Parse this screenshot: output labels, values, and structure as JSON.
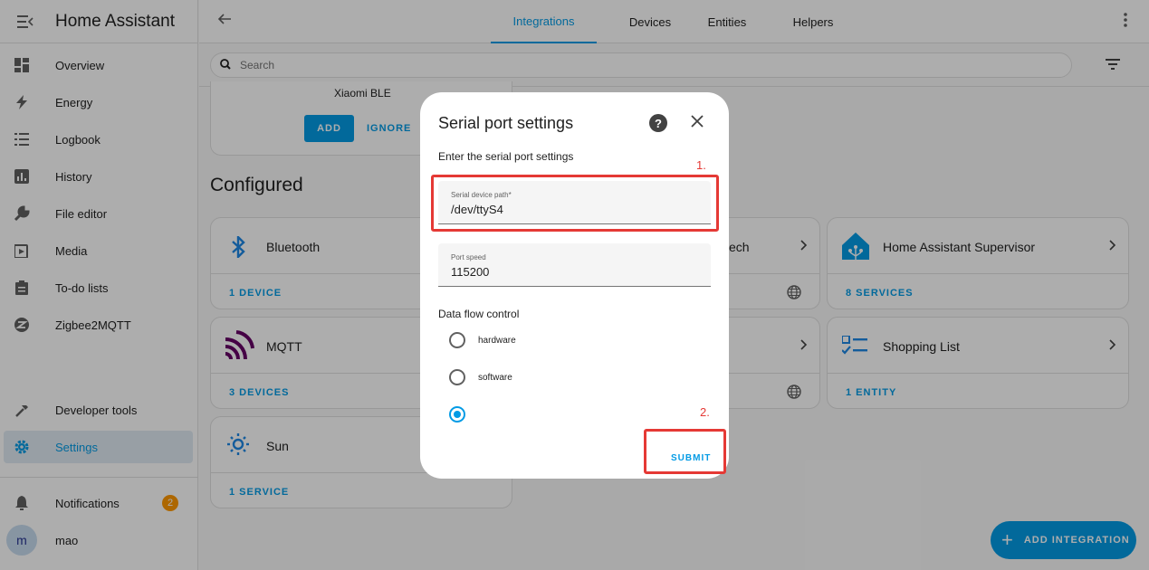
{
  "sidebar": {
    "title": "Home Assistant",
    "items": [
      {
        "label": "Overview"
      },
      {
        "label": "Energy"
      },
      {
        "label": "Logbook"
      },
      {
        "label": "History"
      },
      {
        "label": "File editor"
      },
      {
        "label": "Media"
      },
      {
        "label": "To-do lists"
      },
      {
        "label": "Zigbee2MQTT"
      }
    ],
    "developer_tools": "Developer tools",
    "settings": "Settings",
    "notifications": "Notifications",
    "notifications_count": "2",
    "user_initial": "m",
    "user_name": "mao"
  },
  "topbar": {
    "tabs": [
      "Integrations",
      "Devices",
      "Entities",
      "Helpers"
    ],
    "active_tab": "Integrations"
  },
  "search": {
    "placeholder": "Search"
  },
  "discovered": {
    "name": "Xiaomi BLE",
    "add_label": "ADD",
    "ignore_label": "IGNORE"
  },
  "configured": {
    "heading": "Configured",
    "cards": [
      {
        "name": "Bluetooth",
        "footer": "1 DEVICE"
      },
      {
        "name": "MQTT",
        "footer": "3 DEVICES"
      },
      {
        "name": "Sun",
        "footer": "1 SERVICE"
      },
      {
        "name": "ech",
        "footer": ""
      },
      {
        "name": "Home Assistant Supervisor",
        "footer": "8 SERVICES"
      },
      {
        "name": "Shopping List",
        "footer": "1 ENTITY"
      }
    ]
  },
  "fab": {
    "label": "ADD INTEGRATION"
  },
  "dialog": {
    "title": "Serial port settings",
    "description": "Enter the serial port settings",
    "fields": [
      {
        "label": "Serial device path*",
        "value": "/dev/ttyS4"
      },
      {
        "label": "Port speed",
        "value": "115200"
      }
    ],
    "flow_control_label": "Data flow control",
    "flow_options": [
      "hardware",
      "software",
      ""
    ],
    "selected_option": 2,
    "submit_label": "SUBMIT"
  },
  "annotations": [
    "1.",
    "2."
  ],
  "colors": {
    "accent": "#039be5",
    "annotation": "#e53935",
    "badge": "#ff9800"
  }
}
